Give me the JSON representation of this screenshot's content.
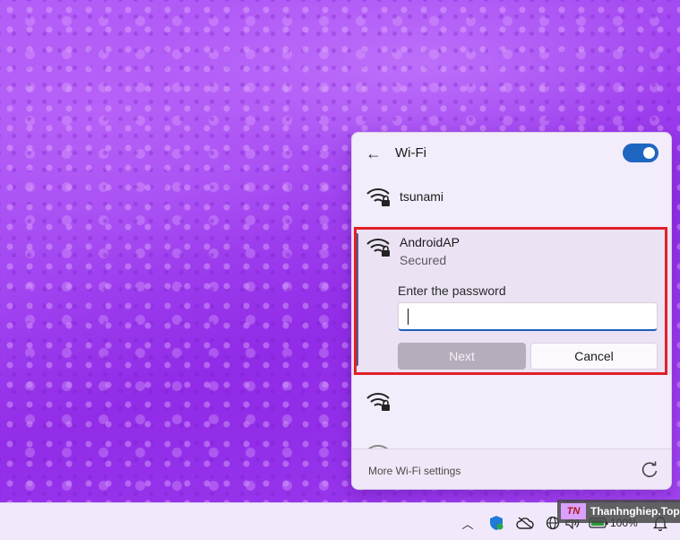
{
  "wifi_panel": {
    "title": "Wi-Fi",
    "toggle_on": true,
    "networks": [
      {
        "name": "tsunami",
        "secured": true
      },
      {
        "name": "AndroidAP",
        "status": "Secured",
        "secured": true
      },
      {
        "name": "",
        "secured": true
      },
      {
        "name": "",
        "secured": false
      }
    ],
    "password": {
      "label": "Enter the password",
      "value": ""
    },
    "buttons": {
      "next": "Next",
      "cancel": "Cancel"
    },
    "footer_link": "More Wi-Fi settings"
  },
  "taskbar": {
    "battery_percent": "100%"
  },
  "watermark": {
    "logo": "TN",
    "text": "Thanhnghiep.Top"
  },
  "colors": {
    "accent": "#1f66c1",
    "highlight": "#e0202a",
    "next_disabled": "#b5adbc"
  },
  "icons": [
    "back-arrow-icon",
    "wifi-lock-icon",
    "refresh-icon",
    "chevron-up-icon",
    "defender-icon",
    "cloud-icon",
    "network-icon",
    "volume-icon",
    "battery-icon",
    "bell-icon"
  ]
}
